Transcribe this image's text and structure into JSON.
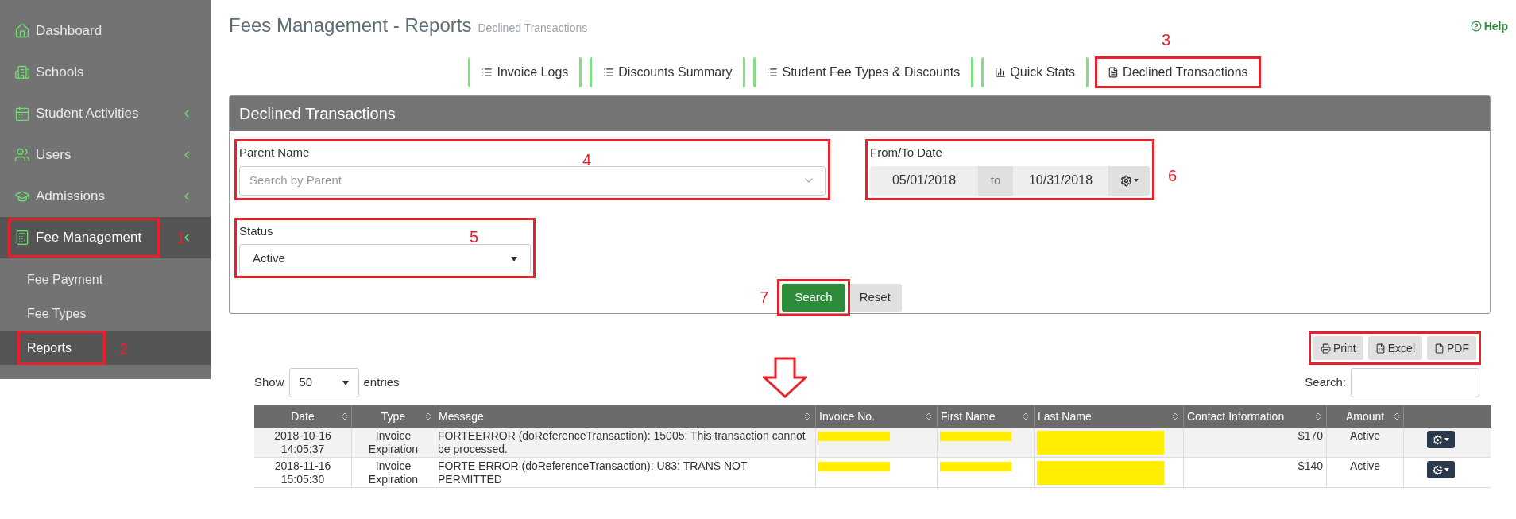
{
  "sidebar": {
    "items": [
      {
        "kind": "home",
        "label": "Dashboard",
        "expandable": false,
        "selected": false,
        "highlighted": false
      },
      {
        "kind": "building",
        "label": "Schools",
        "expandable": false,
        "selected": false,
        "highlighted": false
      },
      {
        "kind": "calendar",
        "label": "Student Activities",
        "expandable": true,
        "selected": false,
        "highlighted": false
      },
      {
        "kind": "users",
        "label": "Users",
        "expandable": true,
        "selected": false,
        "highlighted": false
      },
      {
        "kind": "cap",
        "label": "Admissions",
        "expandable": true,
        "selected": false,
        "highlighted": false
      },
      {
        "kind": "calculator",
        "label": "Fee Management",
        "expandable": true,
        "selected": true,
        "highlighted": true,
        "callout": "1",
        "children": [
          {
            "label": "Fee Payment",
            "selected": false,
            "highlighted": false
          },
          {
            "label": "Fee Types",
            "selected": false,
            "highlighted": false
          },
          {
            "label": "Reports",
            "selected": true,
            "highlighted": true,
            "callout": "2"
          }
        ]
      }
    ]
  },
  "page": {
    "title": "Fees Management - Reports",
    "subtitle": "Declined Transactions",
    "help": "Help"
  },
  "tabs": [
    {
      "kind": "list",
      "label": "Invoice Logs",
      "selected": false,
      "highlighted": false
    },
    {
      "kind": "list",
      "label": "Discounts Summary",
      "selected": false,
      "highlighted": false
    },
    {
      "kind": "list",
      "label": "Student Fee Types & Discounts",
      "selected": false,
      "highlighted": false
    },
    {
      "kind": "chart",
      "label": "Quick Stats",
      "selected": false,
      "highlighted": false
    },
    {
      "kind": "file",
      "label": "Declined Transactions",
      "selected": true,
      "highlighted": true,
      "callout": "3"
    }
  ],
  "panel": {
    "title": "Declined Transactions",
    "parent": {
      "label": "Parent Name",
      "placeholder": "Search by Parent",
      "highlighted": true,
      "callout": "4"
    },
    "status": {
      "label": "Status",
      "value": "Active",
      "highlighted": true,
      "callout": "5"
    },
    "dates": {
      "label": "From/To Date",
      "from": "05/01/2018",
      "separator": "to",
      "to": "10/31/2018",
      "highlighted": true,
      "callout": "6"
    },
    "search_button": {
      "label": "Search",
      "highlighted": true,
      "callout": "7"
    },
    "reset_button": {
      "label": "Reset"
    }
  },
  "export": {
    "highlighted": true,
    "buttons": [
      {
        "kind": "print",
        "label": "Print"
      },
      {
        "kind": "excel",
        "label": "Excel"
      },
      {
        "kind": "pdf",
        "label": "PDF"
      }
    ]
  },
  "annotation_arrow": true,
  "table_controls": {
    "show_label": "Show",
    "page_size": "50",
    "entries_label": "entries",
    "search_label": "Search:"
  },
  "table": {
    "columns": [
      "Date",
      "Type",
      "Message",
      "Invoice No.",
      "First Name",
      "Last Name",
      "Contact Information",
      "Amount"
    ],
    "rows": [
      {
        "date": "2018-10-16 14:05:37",
        "type": "Invoice Expiration",
        "message": "FORTEERROR (doReferenceTransaction): 15005: This transaction cannot be processed.",
        "invoice_redacted": true,
        "first_redacted": true,
        "last_redacted": true,
        "contact": "$170",
        "amount": "Active"
      },
      {
        "date": "2018-11-16 15:05:30",
        "type": "Invoice Expiration",
        "message": "FORTE ERROR (doReferenceTransaction): U83: TRANS NOT PERMITTED",
        "invoice_redacted": true,
        "first_redacted": true,
        "last_redacted": true,
        "contact": "$140",
        "amount": "Active"
      }
    ]
  }
}
